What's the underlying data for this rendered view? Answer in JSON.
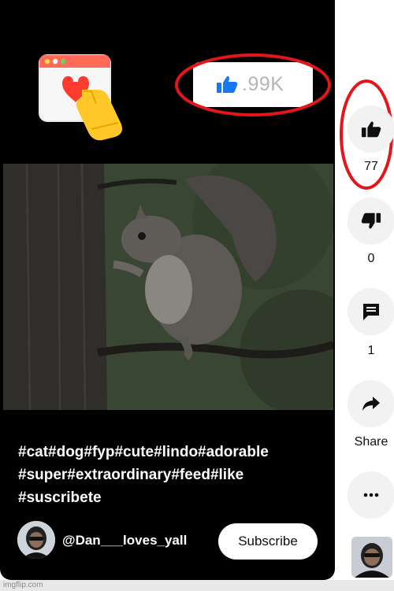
{
  "overlay": {
    "like_count": ".99K"
  },
  "caption": {
    "lines": [
      "#cat#dog#fyp#cute#lindo#adorable",
      "#super#extraordinary#feed#like",
      "#suscribete"
    ]
  },
  "channel": {
    "handle": "@Dan___loves_yall",
    "subscribe_label": "Subscribe"
  },
  "actions": {
    "like_count": "77",
    "dislike_count": "0",
    "comment_count": "1",
    "share_label": "Share"
  },
  "watermark": "imgflip.com",
  "colors": {
    "annotation_red": "#e4161b",
    "like_blue": "#1877f2",
    "action_bg": "#f2f2f2"
  },
  "icons": [
    "like-illustration",
    "thumbs-up-icon",
    "thumbs-down-icon",
    "comment-icon",
    "share-icon",
    "more-icon"
  ]
}
